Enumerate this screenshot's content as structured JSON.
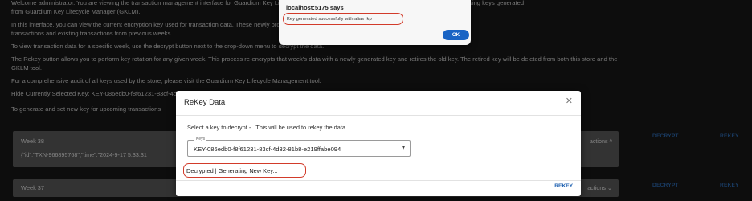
{
  "background": {
    "paragraphs": [
      "Welcome administrator. You are viewing the transaction management interface for Guardium Key Lifecycle Manager to the store. All transactions are securely encrypted using keys generated",
      "from Guardium Key Lifecycle Manager (GKLM).",
      "In this interface, you can view the current encryption key used for transaction data. These newly provisioned keys can be applied to encrypt both upcoming",
      "transactions and existing transactions from previous weeks.",
      "To view transaction data for a specific week, use the decrypt button next to the drop-down menu to decrypt the data.",
      "The Rekey button allows you to perform key rotation for any given week. This process re-encrypts that week's data with a newly generated key and retires the old key. The retired key will be deleted from both this store and the",
      "GKLM tool.",
      "For a comprehensive audit of all keys used by the store, please visit the Guardium Key Lifecycle Management tool.",
      "Hide Currently Selected Key: KEY-086edb0-f8f61231-83cf-4d32-81b8-e219ffabe094",
      "To generate and set new key for upcoming transactions"
    ],
    "weeks": [
      {
        "title": "Week 38",
        "actions": "actions",
        "json": "{\"id\":\"TXN-966895768\",\"time\":\"2024-9-17 5:33:31"
      },
      {
        "title": "Week 37",
        "actions": "actions"
      }
    ],
    "decrypt_label": "DECRYPT",
    "rekey_label": "REKEY"
  },
  "dialog": {
    "title": "ReKey Data",
    "close_icon": "close-icon",
    "description": "Select a key to decrypt - . This will be used to rekey the data",
    "select_legend": "Keys",
    "select_value": "KEY-086edb0-f8f61231-83cf-4d32-81b8-e219ffabe094",
    "status": "Decrypted | Generating New Key...",
    "rekey_button": "REKEY"
  },
  "alert": {
    "title": "localhost:5175 says",
    "message": "Key generated successfully with alias rkp",
    "ok": "OK"
  },
  "colors": {
    "highlight": "#d23b2a",
    "link": "#2f6cb3",
    "ok_button": "#1a64c4"
  }
}
